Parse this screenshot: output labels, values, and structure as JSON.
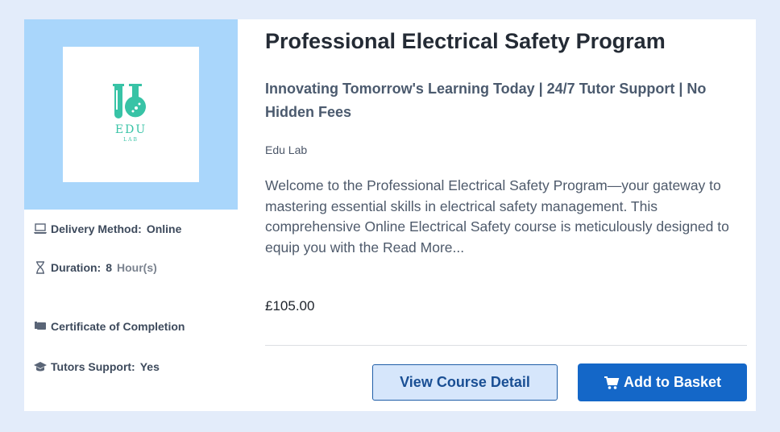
{
  "course": {
    "title": "Professional Electrical Safety Program",
    "subtitle": "Innovating Tomorrow's Learning Today | 24/7 Tutor Support | No Hidden Fees",
    "provider": "Edu Lab",
    "description": "Welcome to the Professional Electrical Safety Program—your gateway to mastering essential skills in electrical safety management. This comprehensive Online Electrical Safety course is meticulously designed to equip you with the",
    "read_more": "Read More...",
    "price": "£105.00"
  },
  "logo": {
    "main": "EDU",
    "sub": "LAB"
  },
  "meta": {
    "delivery_label": "Delivery Method:",
    "delivery_value": "Online",
    "duration_label": "Duration:",
    "duration_value": "8",
    "duration_unit": "Hour(s)",
    "certificate_label": "Certificate of Completion",
    "tutors_label": "Tutors Support:",
    "tutors_value": "Yes"
  },
  "buttons": {
    "view_detail": "View Course Detail",
    "add_basket": "Add to Basket"
  },
  "icons": [
    "laptop-icon",
    "hourglass-icon",
    "certificate-icon",
    "graduation-cap-icon",
    "cart-icon"
  ],
  "colors": {
    "page_bg": "#e3ecfa",
    "thumb_bg": "#a9d6fb",
    "logo_teal": "#38c3a6",
    "primary": "#1467c8",
    "detail_bg": "#d6e6fb"
  }
}
